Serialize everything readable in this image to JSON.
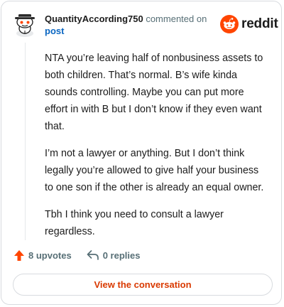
{
  "header": {
    "username": "QuantityAccording750",
    "action_text": "commented on",
    "post_link": "post"
  },
  "brand": {
    "name": "reddit",
    "accent_color": "#ff4500",
    "logo_icon": "reddit-snoo-icon"
  },
  "comment": {
    "paragraphs": [
      "NTA you’re leaving half of nonbusiness assets to both children. That’s normal. B’s wife kinda sounds controlling. Maybe you can put more effort in with B but I don’t know if they even want that.",
      "I’m not a lawyer or anything. But I don’t think legally you’re allowed to give half your business to one son if the other is already an equal owner.",
      "Tbh I think you need to consult a lawyer regardless."
    ]
  },
  "actions": {
    "upvotes_label": "8 upvotes",
    "upvote_icon": "upvote-arrow-icon",
    "replies_label": "0 replies",
    "reply_icon": "reply-arrow-icon"
  },
  "footer": {
    "view_button_label": "View the conversation",
    "view_button_color": "#d93900"
  }
}
